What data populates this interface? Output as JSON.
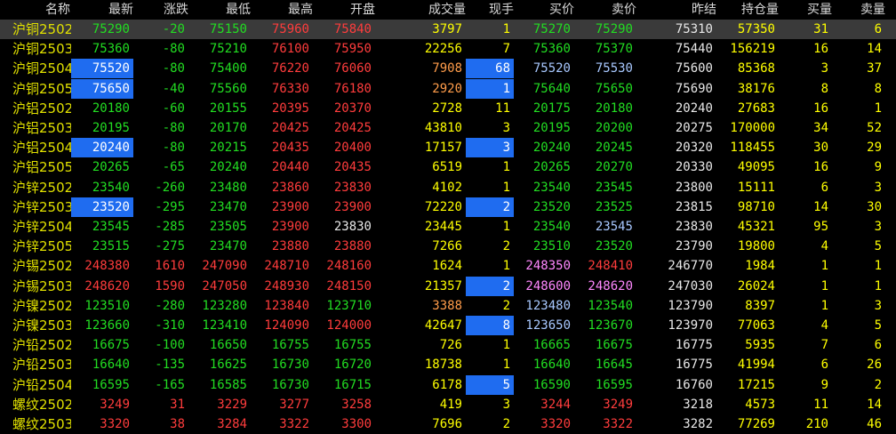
{
  "headers": [
    "名称",
    "最新",
    "涨跌",
    "最低",
    "最高",
    "开盘",
    "成交量",
    "现手",
    "买价",
    "卖价",
    "昨结",
    "持仓量",
    "买量",
    "卖量"
  ],
  "rows": [
    {
      "name": "沪铜2502",
      "last": "75290",
      "chg": "-20",
      "low": "75150",
      "high": "75960",
      "open": "75840",
      "vol": "3797",
      "cur": "1",
      "bid": "75270",
      "ask": "75290",
      "pre": "75310",
      "oi": "57350",
      "bq": "31",
      "aq": "6",
      "sel": true
    },
    {
      "name": "沪铜2503",
      "last": "75360",
      "chg": "-80",
      "low": "75210",
      "high": "76100",
      "open": "75950",
      "vol": "22256",
      "cur": "7",
      "bid": "75360",
      "ask": "75370",
      "pre": "75440",
      "oi": "156219",
      "bq": "16",
      "aq": "14"
    },
    {
      "name": "沪铜2504",
      "last": "75520",
      "chg": "-80",
      "low": "75400",
      "high": "76220",
      "open": "76060",
      "vol": "7908",
      "cur": "68",
      "bid": "75520",
      "ask": "75530",
      "pre": "75600",
      "oi": "85368",
      "bq": "3",
      "aq": "37",
      "hlLast": true,
      "hlCur": true
    },
    {
      "name": "沪铜2505",
      "last": "75650",
      "chg": "-40",
      "low": "75560",
      "high": "76330",
      "open": "76180",
      "vol": "2920",
      "cur": "1",
      "bid": "75640",
      "ask": "75650",
      "pre": "75690",
      "oi": "38176",
      "bq": "8",
      "aq": "8",
      "hlLast": true,
      "hlCur": true
    },
    {
      "name": "沪铝2502",
      "last": "20180",
      "chg": "-60",
      "low": "20155",
      "high": "20395",
      "open": "20370",
      "vol": "2728",
      "cur": "11",
      "bid": "20175",
      "ask": "20180",
      "pre": "20240",
      "oi": "27683",
      "bq": "16",
      "aq": "1"
    },
    {
      "name": "沪铝2503",
      "last": "20195",
      "chg": "-80",
      "low": "20170",
      "high": "20425",
      "open": "20425",
      "vol": "43810",
      "cur": "3",
      "bid": "20195",
      "ask": "20200",
      "pre": "20275",
      "oi": "170000",
      "bq": "34",
      "aq": "52"
    },
    {
      "name": "沪铝2504",
      "last": "20240",
      "chg": "-80",
      "low": "20215",
      "high": "20435",
      "open": "20400",
      "vol": "17157",
      "cur": "3",
      "bid": "20240",
      "ask": "20245",
      "pre": "20320",
      "oi": "118455",
      "bq": "30",
      "aq": "29",
      "hlLast": true,
      "hlCur": true
    },
    {
      "name": "沪铝2505",
      "last": "20265",
      "chg": "-65",
      "low": "20240",
      "high": "20440",
      "open": "20435",
      "vol": "6519",
      "cur": "1",
      "bid": "20265",
      "ask": "20270",
      "pre": "20330",
      "oi": "49095",
      "bq": "16",
      "aq": "9"
    },
    {
      "name": "沪锌2502",
      "last": "23540",
      "chg": "-260",
      "low": "23480",
      "high": "23860",
      "open": "23830",
      "vol": "4102",
      "cur": "1",
      "bid": "23540",
      "ask": "23545",
      "pre": "23800",
      "oi": "15111",
      "bq": "6",
      "aq": "3"
    },
    {
      "name": "沪锌2503",
      "last": "23520",
      "chg": "-295",
      "low": "23470",
      "high": "23900",
      "open": "23900",
      "vol": "72220",
      "cur": "2",
      "bid": "23520",
      "ask": "23525",
      "pre": "23815",
      "oi": "98710",
      "bq": "14",
      "aq": "30",
      "hlLast": true,
      "hlCur": true
    },
    {
      "name": "沪锌2504",
      "last": "23545",
      "chg": "-285",
      "low": "23505",
      "high": "23900",
      "open": "23830",
      "vol": "23445",
      "cur": "1",
      "bid": "23540",
      "ask": "23545",
      "pre": "23830",
      "oi": "45321",
      "bq": "95",
      "aq": "3"
    },
    {
      "name": "沪锌2505",
      "last": "23515",
      "chg": "-275",
      "low": "23470",
      "high": "23880",
      "open": "23880",
      "vol": "7266",
      "cur": "2",
      "bid": "23510",
      "ask": "23520",
      "pre": "23790",
      "oi": "19800",
      "bq": "4",
      "aq": "5"
    },
    {
      "name": "沪锡2502",
      "last": "248380",
      "chg": "1610",
      "low": "247090",
      "high": "248710",
      "open": "248160",
      "vol": "1624",
      "cur": "1",
      "bid": "248350",
      "ask": "248410",
      "pre": "246770",
      "oi": "1984",
      "bq": "1",
      "aq": "1"
    },
    {
      "name": "沪锡2503",
      "last": "248620",
      "chg": "1590",
      "low": "247050",
      "high": "248930",
      "open": "248150",
      "vol": "21357",
      "cur": "2",
      "bid": "248600",
      "ask": "248620",
      "pre": "247030",
      "oi": "26024",
      "bq": "1",
      "aq": "1",
      "hlCur": true
    },
    {
      "name": "沪镍2502",
      "last": "123510",
      "chg": "-280",
      "low": "123280",
      "high": "123840",
      "open": "123710",
      "vol": "3388",
      "cur": "2",
      "bid": "123480",
      "ask": "123540",
      "pre": "123790",
      "oi": "8397",
      "bq": "1",
      "aq": "3"
    },
    {
      "name": "沪镍2503",
      "last": "123660",
      "chg": "-310",
      "low": "123410",
      "high": "124090",
      "open": "124000",
      "vol": "42647",
      "cur": "8",
      "bid": "123650",
      "ask": "123670",
      "pre": "123970",
      "oi": "77063",
      "bq": "4",
      "aq": "5",
      "hlCur": true
    },
    {
      "name": "沪铅2502",
      "last": "16675",
      "chg": "-100",
      "low": "16650",
      "high": "16755",
      "open": "16755",
      "vol": "726",
      "cur": "1",
      "bid": "16665",
      "ask": "16675",
      "pre": "16775",
      "oi": "5935",
      "bq": "7",
      "aq": "6"
    },
    {
      "name": "沪铅2503",
      "last": "16640",
      "chg": "-135",
      "low": "16625",
      "high": "16730",
      "open": "16720",
      "vol": "18738",
      "cur": "1",
      "bid": "16640",
      "ask": "16645",
      "pre": "16775",
      "oi": "41994",
      "bq": "6",
      "aq": "26"
    },
    {
      "name": "沪铅2504",
      "last": "16595",
      "chg": "-165",
      "low": "16585",
      "high": "16730",
      "open": "16715",
      "vol": "6178",
      "cur": "5",
      "bid": "16590",
      "ask": "16595",
      "pre": "16760",
      "oi": "17215",
      "bq": "9",
      "aq": "2",
      "hlCur": true
    },
    {
      "name": "螺纹2502",
      "last": "3249",
      "chg": "31",
      "low": "3229",
      "high": "3277",
      "open": "3258",
      "vol": "419",
      "cur": "3",
      "bid": "3244",
      "ask": "3249",
      "pre": "3218",
      "oi": "4573",
      "bq": "11",
      "aq": "14"
    },
    {
      "name": "螺纹2503",
      "last": "3320",
      "chg": "38",
      "low": "3284",
      "high": "3322",
      "open": "3300",
      "vol": "7696",
      "cur": "2",
      "bid": "3320",
      "ask": "3322",
      "pre": "3282",
      "oi": "77269",
      "bq": "210",
      "aq": "46"
    }
  ],
  "colors": {
    "up": "#ff3c3c",
    "down": "#22dd22",
    "volume": "#ffff00",
    "name": "#e0e000",
    "highlight": "#1f6cf0",
    "selected_row": "#3a3a3a"
  }
}
